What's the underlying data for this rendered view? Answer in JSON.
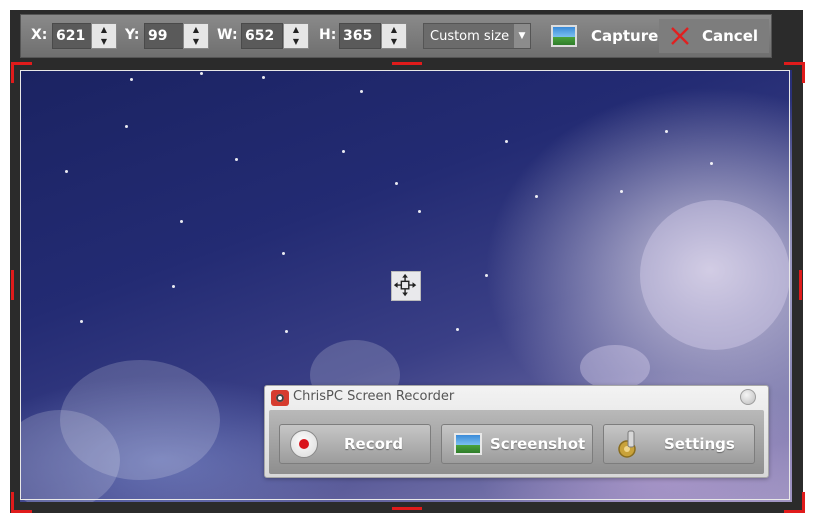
{
  "toolbar": {
    "x_label": "X:",
    "x_value": "621",
    "y_label": "Y:",
    "y_value": "99",
    "w_label": "W:",
    "w_value": "652",
    "h_label": "H:",
    "h_value": "365",
    "size_mode": "Custom size",
    "capture_label": "Capture",
    "cancel_label": "Cancel"
  },
  "recorder": {
    "title": "ChrisPC Screen Recorder",
    "buttons": [
      {
        "label": "Record",
        "icon": "record-icon"
      },
      {
        "label": "Screenshot",
        "icon": "screenshot-icon"
      },
      {
        "label": "Settings",
        "icon": "settings-gear-icon"
      }
    ]
  },
  "colors": {
    "selection_handle": "#e01b1b",
    "toolbar_bg": "#7b7b7b",
    "cancel_icon": "#e02020",
    "record_dot": "#d9141c"
  },
  "icons": {
    "move_handle": "move-arrows-icon",
    "capture": "image-icon",
    "cancel": "x-icon"
  }
}
